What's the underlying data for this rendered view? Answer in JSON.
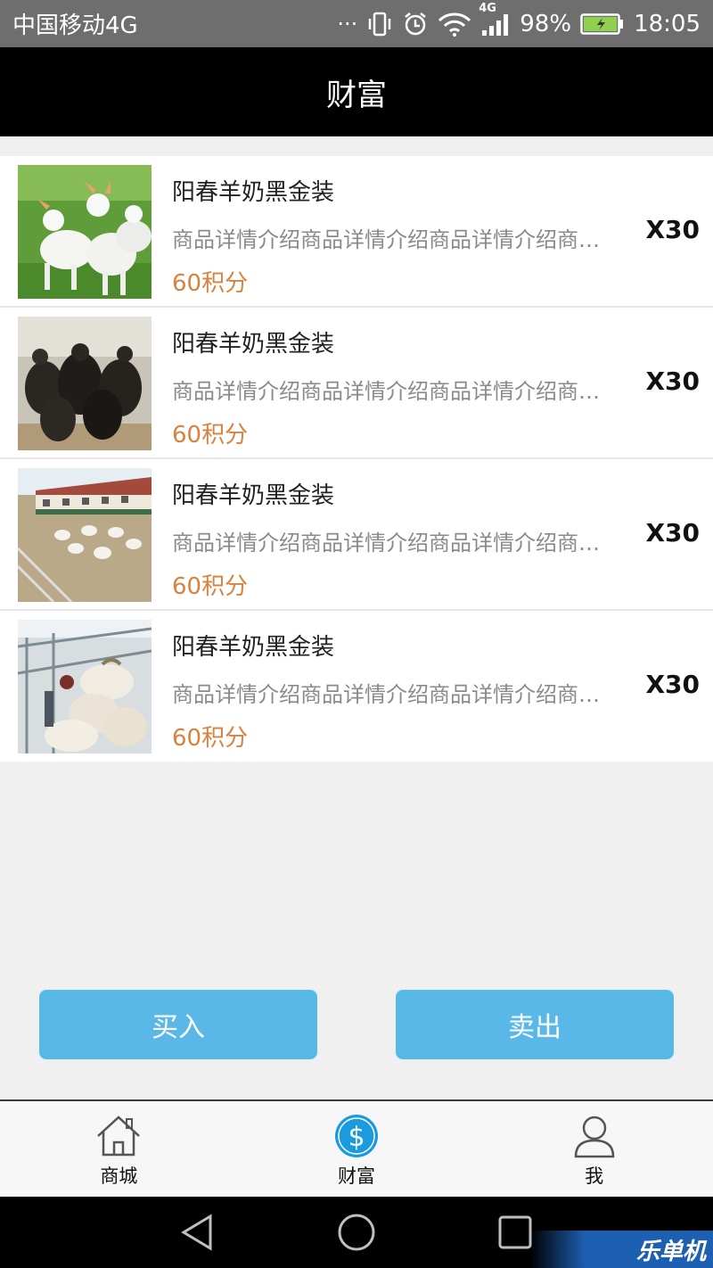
{
  "status_bar": {
    "carrier": "中国移动4G",
    "dots": "···",
    "network_badge": "4G",
    "battery": "98%",
    "time": "18:05"
  },
  "header": {
    "title": "财富"
  },
  "products": [
    {
      "title": "阳春羊奶黑金装",
      "description": "商品详情介绍商品详情介绍商品详情介绍商品详情介绍",
      "points": "60积分",
      "quantity": "X30",
      "image": "white-goats-in-grass"
    },
    {
      "title": "阳春羊奶黑金装",
      "description": "商品详情介绍商品详情介绍商品详情介绍商品详情介绍",
      "points": "60积分",
      "quantity": "X30",
      "image": "black-goats-herd"
    },
    {
      "title": "阳春羊奶黑金装",
      "description": "商品详情介绍商品详情介绍商品详情介绍商品详情介绍",
      "points": "60积分",
      "quantity": "X30",
      "image": "goat-farm-barn"
    },
    {
      "title": "阳春羊奶黑金装",
      "description": "商品详情介绍商品详情介绍商品详情介绍商品详情介绍",
      "points": "60积分",
      "quantity": "X30",
      "image": "goats-milking-station"
    }
  ],
  "actions": {
    "buy_label": "买入",
    "sell_label": "卖出"
  },
  "tabs": [
    {
      "label": "商城",
      "icon": "home-icon",
      "active": false
    },
    {
      "label": "财富",
      "icon": "dollar-icon",
      "active": true
    },
    {
      "label": "我",
      "icon": "user-icon",
      "active": false
    }
  ],
  "watermark": "乐单机",
  "colors": {
    "accent": "#5ab8e8",
    "points": "#d9823f",
    "tab_active": "#1a9be0"
  }
}
